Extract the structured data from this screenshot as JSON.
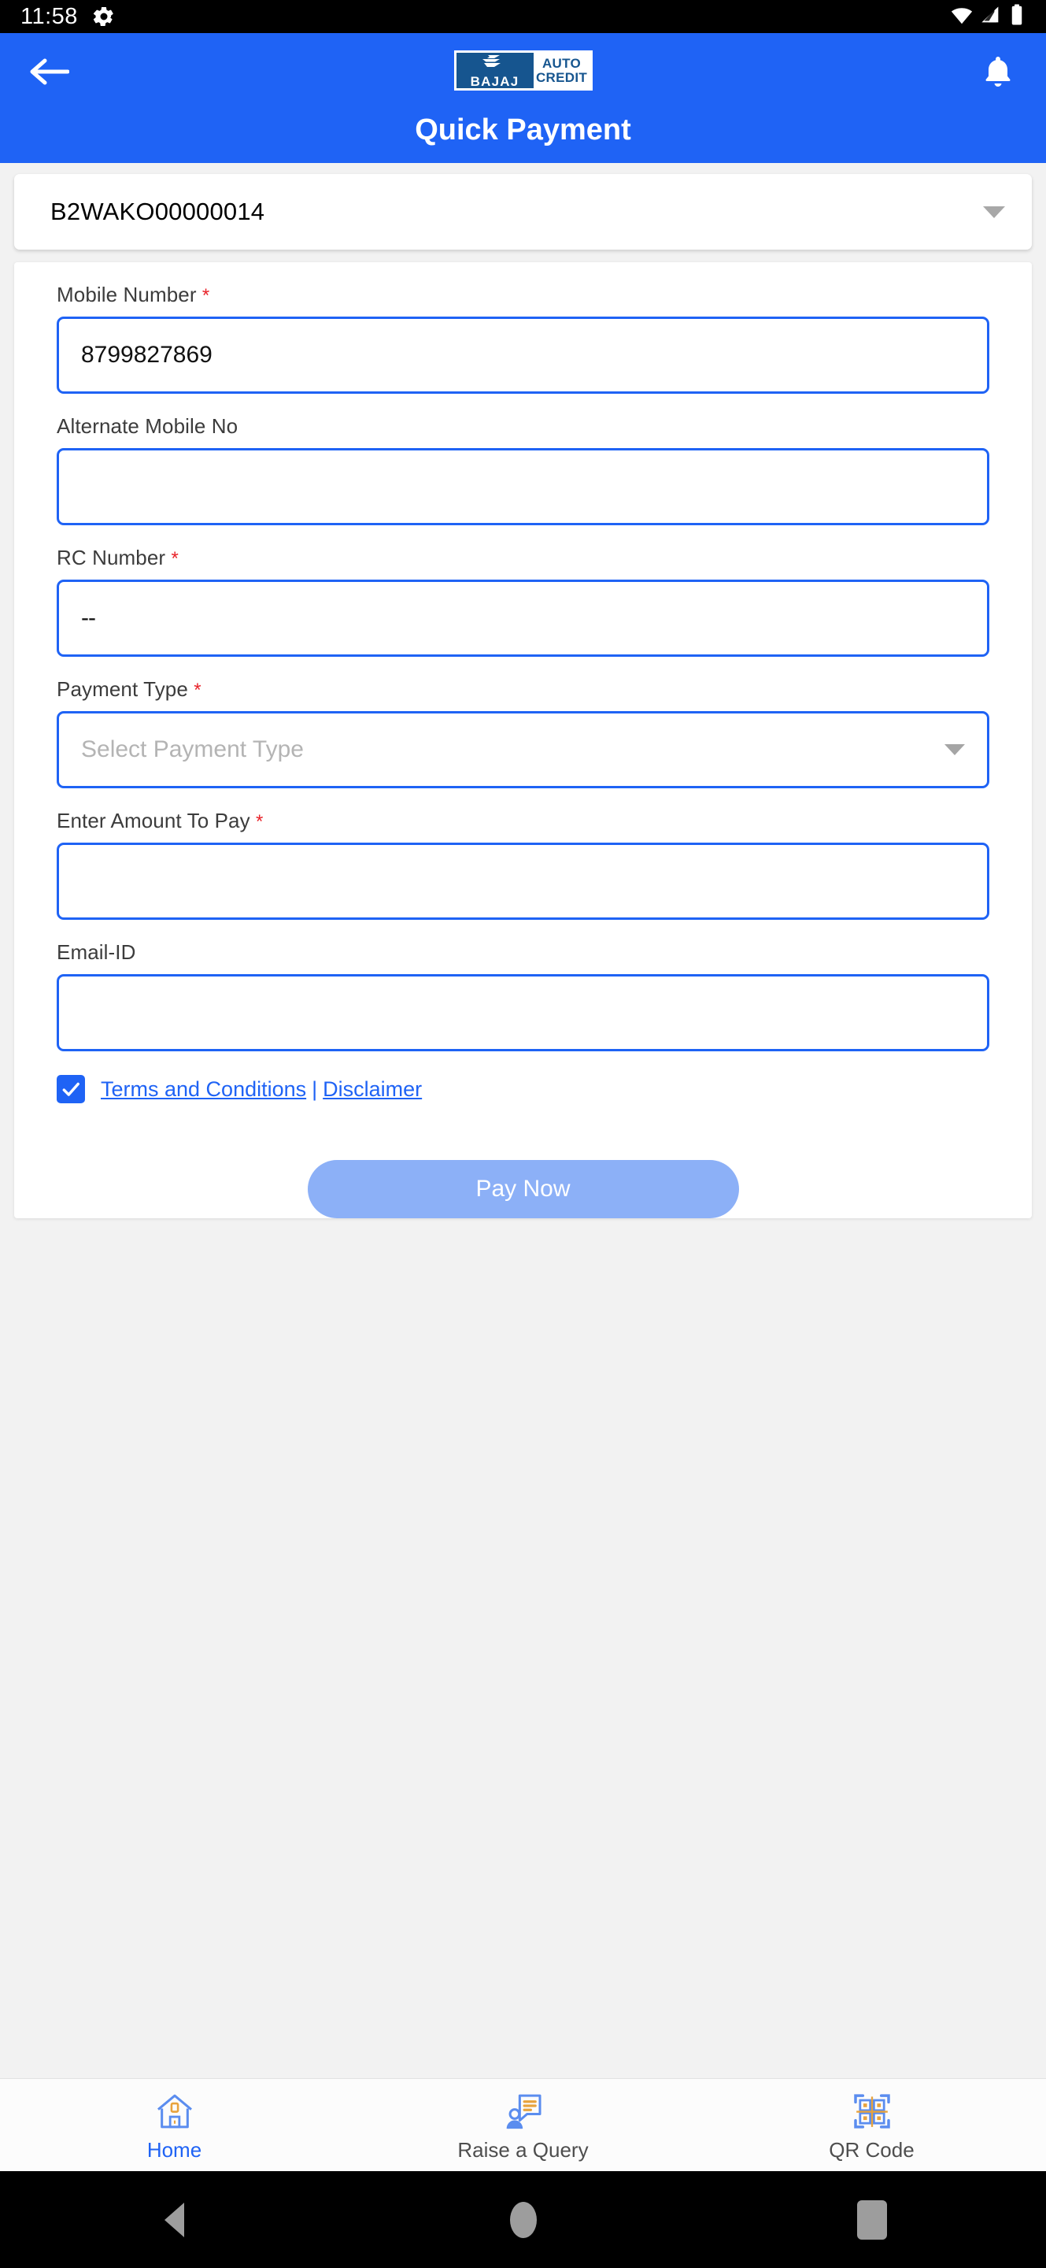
{
  "status_bar": {
    "time": "11:58",
    "gear_icon": "gear-icon",
    "wifi_icon": "wifi-icon",
    "signal_icon": "signal-icon",
    "battery_icon": "battery-icon"
  },
  "header": {
    "back_icon": "back-arrow-icon",
    "notification_icon": "bell-icon",
    "brand": {
      "bajaj": "BAJAJ",
      "auto": "AUTO",
      "credit": "CREDIT"
    },
    "title": "Quick Payment",
    "bg_color": "#1f63f5"
  },
  "account_select": {
    "name": "loan-account-select",
    "value": "B2WAKO00000014",
    "caret_icon": "chevron-down-icon"
  },
  "form": {
    "fields": [
      {
        "label": "Mobile Number",
        "required": true,
        "value": "8799827869",
        "placeholder": "",
        "type": "text"
      },
      {
        "label": "Alternate Mobile No",
        "required": false,
        "value": "",
        "placeholder": "",
        "type": "text"
      },
      {
        "label": "RC Number",
        "required": true,
        "value": "--",
        "placeholder": "",
        "type": "text"
      },
      {
        "label": "Payment Type",
        "required": true,
        "value": "",
        "placeholder": "Select Payment Type",
        "type": "select"
      },
      {
        "label": "Enter Amount To Pay",
        "required": true,
        "value": "",
        "placeholder": "",
        "type": "text"
      },
      {
        "label": "Email-ID",
        "required": false,
        "value": "",
        "placeholder": "",
        "type": "text"
      }
    ],
    "required_marker": "*",
    "terms": {
      "checked": true,
      "checkbox_icon": "checkmark-icon",
      "terms_label": "Terms and Conditions",
      "separator": "|",
      "disclaimer_label": "Disclaimer"
    },
    "pay_button": {
      "label": "Pay Now",
      "enabled": false,
      "color": "#8cb0f7"
    }
  },
  "tabbar": {
    "items": [
      {
        "label": "Home",
        "icon": "home-icon",
        "active": true
      },
      {
        "label": "Raise a Query",
        "icon": "query-chat-icon",
        "active": false
      },
      {
        "label": "QR Code",
        "icon": "qr-code-icon",
        "active": false
      }
    ]
  },
  "android_nav": {
    "back": "nav-back-icon",
    "home": "nav-home-icon",
    "recents": "nav-recents-icon"
  },
  "colors": {
    "primary": "#1f63f5",
    "brand_dark_blue": "#16558f",
    "required_red": "#e8232a",
    "disabled_button": "#8cb0f7"
  }
}
